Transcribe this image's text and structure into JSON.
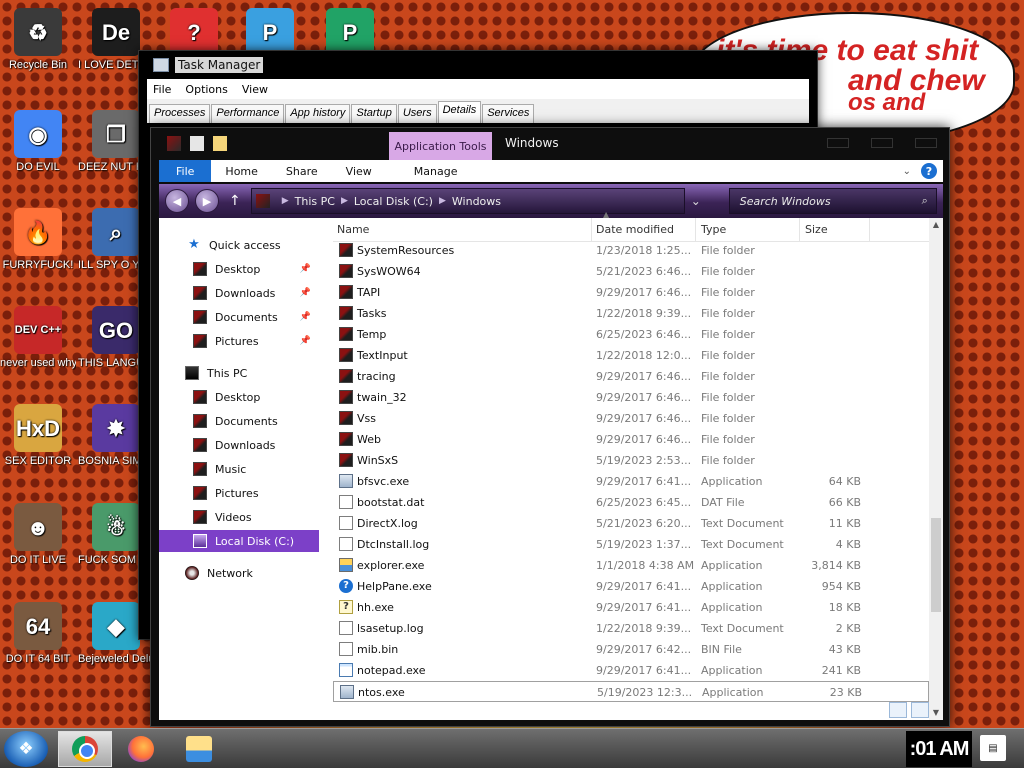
{
  "desktop": {
    "icons": [
      {
        "label": "Recycle Bin",
        "glyph": "♻",
        "color": "#3a3a3a"
      },
      {
        "label": "I LOVE DETECTING",
        "glyph": "De",
        "color": "#1d1d1d"
      },
      {
        "label": "",
        "glyph": "?",
        "color": "#e03030"
      },
      {
        "label": "",
        "glyph": "P",
        "color": "#3aa0e0"
      },
      {
        "label": "",
        "glyph": "P",
        "color": "#21a366"
      },
      {
        "label": "DO EVIL",
        "glyph": "◉",
        "color": "#4285f4"
      },
      {
        "label": "DEEZ NUT HAH GOTT",
        "glyph": "❐",
        "color": "#6a6a6a"
      },
      {
        "label": "FURRYFUCK!",
        "glyph": "🔥",
        "color": "#ff7139"
      },
      {
        "label": "ILL SPY O YOU",
        "glyph": "⌕",
        "color": "#3c6cb0"
      },
      {
        "label": "never used why is it ...",
        "glyph": "DEV C++",
        "color": "#c62828"
      },
      {
        "label": "THIS LANGUAGE",
        "glyph": "GO",
        "color": "#3a2a6a"
      },
      {
        "label": "SEX EDITOR",
        "glyph": "HxD",
        "color": "#d9a640"
      },
      {
        "label": "BOSNIA SIMULATO",
        "glyph": "✸",
        "color": "#5a3aa0"
      },
      {
        "label": "DO IT LIVE",
        "glyph": "☻",
        "color": "#7a5a40"
      },
      {
        "label": "FUCK SOM ELVES",
        "glyph": "☃",
        "color": "#4a9a6a"
      },
      {
        "label": "DO IT 64 BIT",
        "glyph": "64",
        "color": "#7a5a40"
      },
      {
        "label": "Bejeweled Deluxe",
        "glyph": "◆",
        "color": "#2aa8c8"
      }
    ]
  },
  "bubble": {
    "line1": "it's time to eat shit",
    "line2": "and chew",
    "line3": "os and"
  },
  "task_manager": {
    "title": "Task Manager",
    "menu": [
      "File",
      "Options",
      "View"
    ],
    "tabs": [
      "Processes",
      "Performance",
      "App history",
      "Startup",
      "Users",
      "Details",
      "Services"
    ],
    "active_tab": "Details"
  },
  "explorer": {
    "title": "Windows",
    "app_tools": "Application Tools",
    "ribbon": {
      "file": "File",
      "home": "Home",
      "share": "Share",
      "view": "View",
      "manage": "Manage"
    },
    "address": {
      "crumbs": [
        "This PC",
        "Local Disk (C:)",
        "Windows"
      ]
    },
    "search_placeholder": "Search Windows",
    "nav": {
      "quick_access": "Quick access",
      "quick_items": [
        "Desktop",
        "Downloads",
        "Documents",
        "Pictures"
      ],
      "this_pc": "This PC",
      "pc_items": [
        "Desktop",
        "Documents",
        "Downloads",
        "Music",
        "Pictures",
        "Videos",
        "Local Disk (C:)"
      ],
      "network": "Network"
    },
    "columns": {
      "name": "Name",
      "date": "Date modified",
      "type": "Type",
      "size": "Size"
    },
    "files": [
      {
        "name": "SystemResources",
        "date": "1/23/2018 1:25...",
        "type": "File folder",
        "size": "",
        "icon": "red"
      },
      {
        "name": "SysWOW64",
        "date": "5/21/2023 6:46...",
        "type": "File folder",
        "size": "",
        "icon": "red"
      },
      {
        "name": "TAPI",
        "date": "9/29/2017 6:46...",
        "type": "File folder",
        "size": "",
        "icon": "red"
      },
      {
        "name": "Tasks",
        "date": "1/22/2018 9:39...",
        "type": "File folder",
        "size": "",
        "icon": "red"
      },
      {
        "name": "Temp",
        "date": "6/25/2023 6:46...",
        "type": "File folder",
        "size": "",
        "icon": "red"
      },
      {
        "name": "TextInput",
        "date": "1/22/2018 12:0...",
        "type": "File folder",
        "size": "",
        "icon": "red"
      },
      {
        "name": "tracing",
        "date": "9/29/2017 6:46...",
        "type": "File folder",
        "size": "",
        "icon": "red"
      },
      {
        "name": "twain_32",
        "date": "9/29/2017 6:46...",
        "type": "File folder",
        "size": "",
        "icon": "red"
      },
      {
        "name": "Vss",
        "date": "9/29/2017 6:46...",
        "type": "File folder",
        "size": "",
        "icon": "red"
      },
      {
        "name": "Web",
        "date": "9/29/2017 6:46...",
        "type": "File folder",
        "size": "",
        "icon": "red"
      },
      {
        "name": "WinSxS",
        "date": "5/19/2023 2:53...",
        "type": "File folder",
        "size": "",
        "icon": "red"
      },
      {
        "name": "bfsvc.exe",
        "date": "9/29/2017 6:41...",
        "type": "Application",
        "size": "64 KB",
        "icon": "app"
      },
      {
        "name": "bootstat.dat",
        "date": "6/25/2023 6:45...",
        "type": "DAT File",
        "size": "66 KB",
        "icon": "doc"
      },
      {
        "name": "DirectX.log",
        "date": "5/21/2023 6:20...",
        "type": "Text Document",
        "size": "11 KB",
        "icon": "doc"
      },
      {
        "name": "DtcInstall.log",
        "date": "5/19/2023 1:37...",
        "type": "Text Document",
        "size": "4 KB",
        "icon": "doc"
      },
      {
        "name": "explorer.exe",
        "date": "1/1/2018 4:38 AM",
        "type": "Application",
        "size": "3,814 KB",
        "icon": "explorer"
      },
      {
        "name": "HelpPane.exe",
        "date": "9/29/2017 6:41...",
        "type": "Application",
        "size": "954 KB",
        "icon": "help"
      },
      {
        "name": "hh.exe",
        "date": "9/29/2017 6:41...",
        "type": "Application",
        "size": "18 KB",
        "icon": "hh"
      },
      {
        "name": "lsasetup.log",
        "date": "1/22/2018 9:39...",
        "type": "Text Document",
        "size": "2 KB",
        "icon": "doc"
      },
      {
        "name": "mib.bin",
        "date": "9/29/2017 6:42...",
        "type": "BIN File",
        "size": "43 KB",
        "icon": "doc"
      },
      {
        "name": "notepad.exe",
        "date": "9/29/2017 6:41...",
        "type": "Application",
        "size": "241 KB",
        "icon": "notepad"
      },
      {
        "name": "ntos.exe",
        "date": "5/19/2023 12:3...",
        "type": "Application",
        "size": "23 KB",
        "icon": "app"
      }
    ]
  },
  "taskbar": {
    "clock": ":01 AM",
    "apps": [
      "chrome",
      "firefox",
      "file-explorer"
    ]
  },
  "colors": {
    "accent": "#1b6fd1",
    "selected_nav": "#7c40c8",
    "app_tools": "#d8a8e6"
  }
}
